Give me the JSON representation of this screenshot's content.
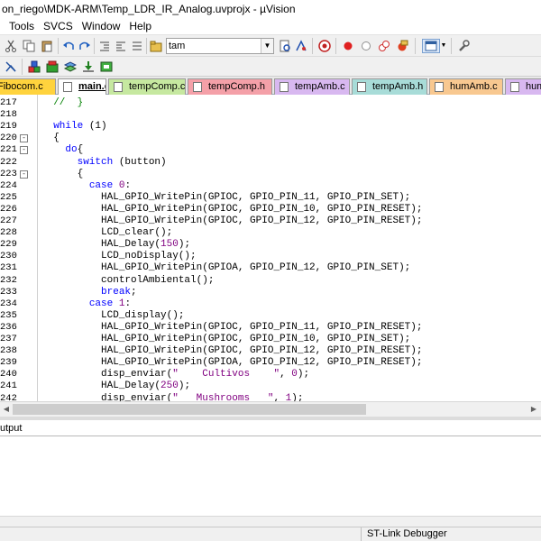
{
  "window": {
    "title": "on_riego\\MDK-ARM\\Temp_LDR_IR_Analog.uvprojx - µVision"
  },
  "menu": [
    "Tools",
    "SVCS",
    "Window",
    "Help"
  ],
  "toolbar": {
    "target_combo_value": "tam"
  },
  "tabs": [
    {
      "label": "Fibocom.c",
      "color": "#ffd33d",
      "active": false
    },
    {
      "label": "main.c",
      "color": "#ffffff",
      "active": true
    },
    {
      "label": "tempComp.c",
      "color": "#c6e8a0",
      "active": false
    },
    {
      "label": "tempComp.h",
      "color": "#f4a0a8",
      "active": false
    },
    {
      "label": "tempAmb.c",
      "color": "#d8b8f0",
      "active": false
    },
    {
      "label": "tempAmb.h",
      "color": "#a8dcd8",
      "active": false
    },
    {
      "label": "humAmb.c",
      "color": "#f8c890",
      "active": false
    },
    {
      "label": "hum",
      "color": "#d8b8f0",
      "active": false
    }
  ],
  "editor": {
    "lines": [
      {
        "n": "217",
        "fold": "",
        "segs": [
          {
            "t": "  ",
            "c": ""
          },
          {
            "t": "//  }",
            "c": "cmt"
          }
        ]
      },
      {
        "n": "218",
        "fold": "",
        "segs": []
      },
      {
        "n": "219",
        "fold": "",
        "segs": [
          {
            "t": "  ",
            "c": ""
          },
          {
            "t": "while",
            "c": "kw"
          },
          {
            "t": " (1)",
            "c": ""
          }
        ]
      },
      {
        "n": "220",
        "fold": "-",
        "segs": [
          {
            "t": "  {",
            "c": ""
          }
        ]
      },
      {
        "n": "221",
        "fold": "-",
        "segs": [
          {
            "t": "    ",
            "c": ""
          },
          {
            "t": "do",
            "c": "kw"
          },
          {
            "t": "{",
            "c": ""
          }
        ]
      },
      {
        "n": "222",
        "fold": "",
        "segs": [
          {
            "t": "      ",
            "c": ""
          },
          {
            "t": "switch",
            "c": "kw"
          },
          {
            "t": " (button)",
            "c": ""
          }
        ]
      },
      {
        "n": "223",
        "fold": "-",
        "segs": [
          {
            "t": "      {",
            "c": ""
          }
        ]
      },
      {
        "n": "224",
        "fold": "",
        "segs": [
          {
            "t": "        ",
            "c": ""
          },
          {
            "t": "case",
            "c": "kw"
          },
          {
            "t": " ",
            "c": ""
          },
          {
            "t": "0",
            "c": "num"
          },
          {
            "t": ":",
            "c": ""
          }
        ]
      },
      {
        "n": "225",
        "fold": "",
        "segs": [
          {
            "t": "          HAL_GPIO_WritePin(GPIOC, GPIO_PIN_11, GPIO_PIN_SET);",
            "c": ""
          }
        ]
      },
      {
        "n": "226",
        "fold": "",
        "segs": [
          {
            "t": "          HAL_GPIO_WritePin(GPIOC, GPIO_PIN_10, GPIO_PIN_RESET);",
            "c": ""
          }
        ]
      },
      {
        "n": "227",
        "fold": "",
        "segs": [
          {
            "t": "          HAL_GPIO_WritePin(GPIOC, GPIO_PIN_12, GPIO_PIN_RESET);",
            "c": ""
          }
        ]
      },
      {
        "n": "228",
        "fold": "",
        "segs": [
          {
            "t": "          LCD_clear();",
            "c": ""
          }
        ]
      },
      {
        "n": "229",
        "fold": "",
        "segs": [
          {
            "t": "          HAL_Delay(",
            "c": ""
          },
          {
            "t": "150",
            "c": "num"
          },
          {
            "t": ");",
            "c": ""
          }
        ]
      },
      {
        "n": "230",
        "fold": "",
        "segs": [
          {
            "t": "          LCD_noDisplay();",
            "c": ""
          }
        ]
      },
      {
        "n": "231",
        "fold": "",
        "segs": [
          {
            "t": "          HAL_GPIO_WritePin(GPIOA, GPIO_PIN_12, GPIO_PIN_SET);",
            "c": ""
          }
        ]
      },
      {
        "n": "232",
        "fold": "",
        "segs": [
          {
            "t": "          controlAmbiental();",
            "c": ""
          }
        ]
      },
      {
        "n": "233",
        "fold": "",
        "segs": [
          {
            "t": "          ",
            "c": ""
          },
          {
            "t": "break",
            "c": "kw"
          },
          {
            "t": ";",
            "c": ""
          }
        ]
      },
      {
        "n": "234",
        "fold": "",
        "segs": [
          {
            "t": "        ",
            "c": ""
          },
          {
            "t": "case",
            "c": "kw"
          },
          {
            "t": " ",
            "c": ""
          },
          {
            "t": "1",
            "c": "num"
          },
          {
            "t": ":",
            "c": ""
          }
        ]
      },
      {
        "n": "235",
        "fold": "",
        "segs": [
          {
            "t": "          LCD_display();",
            "c": ""
          }
        ]
      },
      {
        "n": "236",
        "fold": "",
        "segs": [
          {
            "t": "          HAL_GPIO_WritePin(GPIOC, GPIO_PIN_11, GPIO_PIN_RESET);",
            "c": ""
          }
        ]
      },
      {
        "n": "237",
        "fold": "",
        "segs": [
          {
            "t": "          HAL_GPIO_WritePin(GPIOC, GPIO_PIN_10, GPIO_PIN_SET);",
            "c": ""
          }
        ]
      },
      {
        "n": "238",
        "fold": "",
        "segs": [
          {
            "t": "          HAL_GPIO_WritePin(GPIOC, GPIO_PIN_12, GPIO_PIN_RESET);",
            "c": ""
          }
        ]
      },
      {
        "n": "239",
        "fold": "",
        "segs": [
          {
            "t": "          HAL_GPIO_WritePin(GPIOA, GPIO_PIN_12, GPIO_PIN_RESET);",
            "c": ""
          }
        ]
      },
      {
        "n": "240",
        "fold": "",
        "segs": [
          {
            "t": "          disp_enviar(",
            "c": ""
          },
          {
            "t": "\"    Cultivos    \"",
            "c": "str"
          },
          {
            "t": ", ",
            "c": ""
          },
          {
            "t": "0",
            "c": "num"
          },
          {
            "t": ");",
            "c": ""
          }
        ]
      },
      {
        "n": "241",
        "fold": "",
        "segs": [
          {
            "t": "          HAL_Delay(",
            "c": ""
          },
          {
            "t": "250",
            "c": "num"
          },
          {
            "t": ");",
            "c": ""
          }
        ]
      },
      {
        "n": "242",
        "fold": "",
        "segs": [
          {
            "t": "          disp_enviar(",
            "c": ""
          },
          {
            "t": "\"   Mushrooms   \"",
            "c": "str"
          },
          {
            "t": ", ",
            "c": ""
          },
          {
            "t": "1",
            "c": "num"
          },
          {
            "t": ");",
            "c": ""
          }
        ]
      }
    ]
  },
  "output": {
    "title": "utput"
  },
  "status": {
    "debugger": "ST-Link Debugger"
  },
  "colors": {
    "keyword": "#0000ff",
    "number": "#800080",
    "comment": "#008000"
  }
}
